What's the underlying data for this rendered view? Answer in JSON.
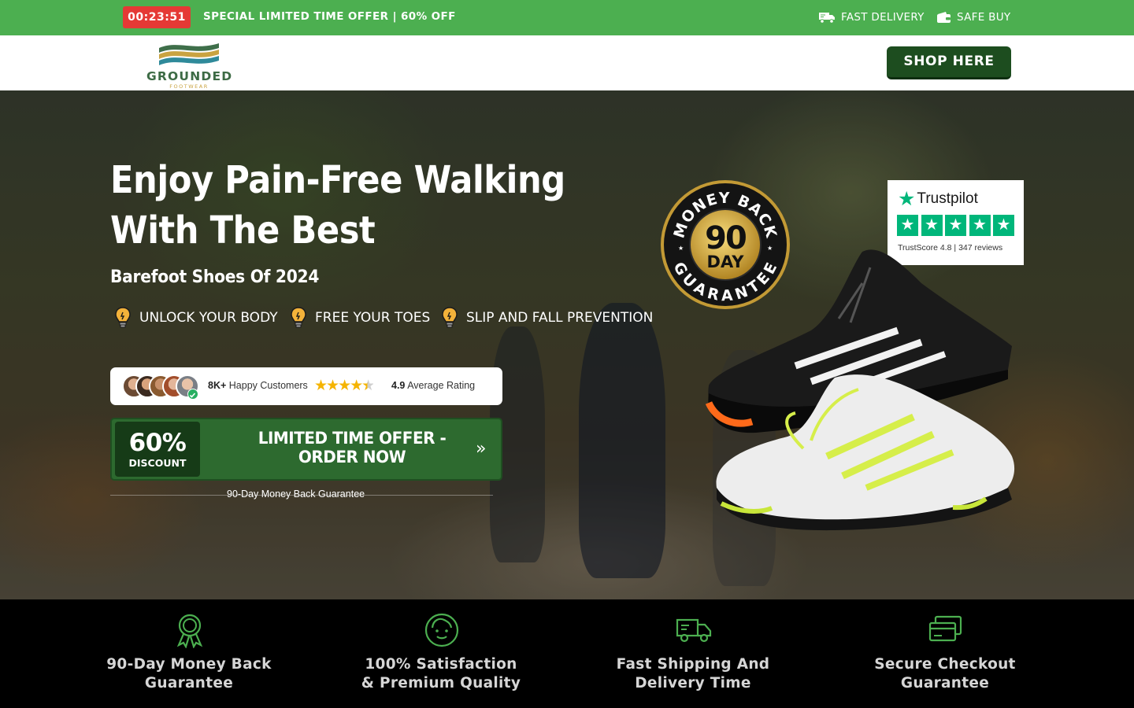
{
  "topbar": {
    "timer": "00:23:51",
    "promo": "SPECIAL LIMITED TIME OFFER | 60% OFF",
    "perks": [
      {
        "label": "FAST DELIVERY",
        "icon": "truck-icon"
      },
      {
        "label": "SAFE BUY",
        "icon": "wallet-icon"
      }
    ],
    "bg_color": "#4caf50",
    "timer_color": "#e53935"
  },
  "header": {
    "logo": {
      "name": "GROUNDED",
      "tagline": "FOOTWEAR"
    },
    "shop_button": "SHOP HERE",
    "button_color": "#1d4d1f"
  },
  "hero": {
    "title": "Enjoy Pain-Free Walking With The Best",
    "subtitle": "Barefoot Shoes Of 2024",
    "features": [
      "UNLOCK YOUR BODY",
      "FREE YOUR TOES",
      "SLIP AND FALL PREVENTION"
    ],
    "social_proof": {
      "customers_count": "8K+",
      "customers_label": "Happy Customers",
      "rating_value": "4.9",
      "rating_label": "Average Rating",
      "stars": 4.5
    },
    "cta": {
      "discount_value": "60%",
      "discount_label": "DISCOUNT",
      "text": "LIMITED TIME OFFER - ORDER NOW",
      "arrow_icon": "double-chevron-right-icon"
    },
    "guarantee_note": "90-Day Money Back Guarantee",
    "seal": {
      "top_text": "MONEY BACK",
      "number": "90",
      "unit": "DAY",
      "bottom_text": "GUARANTEE"
    },
    "trustpilot": {
      "brand": "Trustpilot",
      "stars": 5,
      "score_label": "TrustScore",
      "score": "4.8",
      "reviews": "347 reviews"
    }
  },
  "features_strip": [
    {
      "title_lines": [
        "90-Day Money Back",
        "Guarantee"
      ],
      "icon": "award-ribbon-icon"
    },
    {
      "title_lines": [
        "100% Satisfaction",
        "& Premium Quality"
      ],
      "icon": "happy-face-icon"
    },
    {
      "title_lines": [
        "Fast Shipping And",
        "Delivery Time"
      ],
      "icon": "delivery-truck-icon"
    },
    {
      "title_lines": [
        "Secure Checkout",
        "Guarantee"
      ],
      "icon": "credit-cards-icon"
    }
  ],
  "accent_color": "#4caf50"
}
